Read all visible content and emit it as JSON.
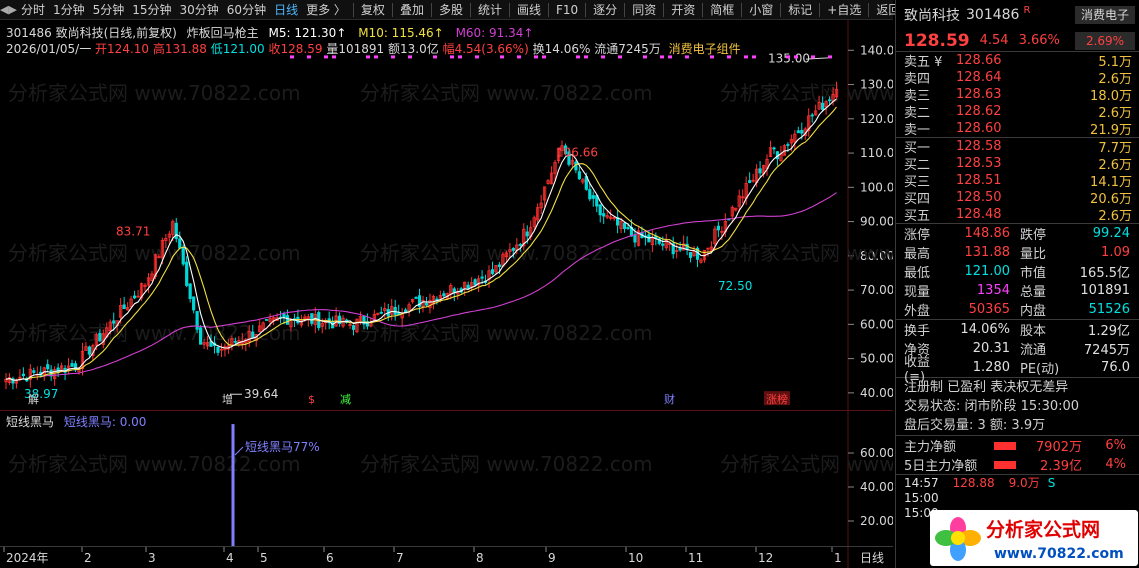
{
  "toolbar": {
    "items": [
      "分时",
      "1分钟",
      "5分钟",
      "15分钟",
      "30分钟",
      "60分钟",
      "日线",
      "更多 〉",
      "复权",
      "叠加",
      "多股",
      "统计",
      "画线",
      "F10",
      "逐分",
      "同资",
      "开资",
      "简框",
      "小窗",
      "标记",
      "+自选",
      "返回"
    ],
    "active": "日线"
  },
  "header": {
    "line1": {
      "code_name": "301486 致尚科技(日线,前复权)",
      "indicator": "炸板回马枪主",
      "m5": "M5: 121.30↑",
      "m10": "M10: 115.46↑",
      "m60": "M60: 91.34↑"
    },
    "line2": {
      "date": "2026/01/05/一",
      "open": "开124.10",
      "high": "高131.88",
      "low": "低121.00",
      "close": "收128.59",
      "vol": "量101891",
      "amt": "额13.0亿",
      "amp": "幅4.54(3.66%)",
      "turn": "换14.06%",
      "float": "流通7245万",
      "sector": "消费电子组件"
    }
  },
  "colors": {
    "up": "#ff3030",
    "down": "#00d8d8",
    "ma5": "#ffffff",
    "ma10": "#f0e040",
    "ma60": "#d040d0",
    "signal": "#8080ff"
  },
  "chart_data": {
    "type": "candlestick",
    "y_ticks": [
      "140.00",
      "130.00",
      "120.00",
      "110.00",
      "100.00",
      "90.00",
      "80.00",
      "70.00",
      "60.00",
      "50.00",
      "40.00"
    ],
    "ylim": [
      35,
      143
    ],
    "x_months": [
      "2024年",
      "2",
      "3",
      "4",
      "5",
      "6",
      "7",
      "8",
      "9",
      "10",
      "11",
      "12",
      "1"
    ],
    "x_period": "日线",
    "annotations": {
      "max1": "83.71",
      "max2": "106.66",
      "max3": "135.00",
      "min1": "39.64",
      "min2": "72.50",
      "min0": "38.97"
    },
    "markers": [
      "解",
      "增",
      "$",
      "减",
      "财",
      "涨榜"
    ],
    "key_points": [
      {
        "label": "2024年",
        "close": 44
      },
      {
        "label": "2",
        "close": 48
      },
      {
        "label": "3",
        "close": 72
      },
      {
        "label": "4",
        "close": 52
      },
      {
        "label": "5",
        "close": 62
      },
      {
        "label": "6",
        "close": 60
      },
      {
        "label": "7",
        "close": 67
      },
      {
        "label": "8",
        "close": 75
      },
      {
        "label": "9",
        "close": 100
      },
      {
        "label": "10",
        "close": 86
      },
      {
        "label": "11",
        "close": 80
      },
      {
        "label": "12",
        "close": 110
      },
      {
        "label": "1",
        "close": 128.59
      }
    ]
  },
  "sub_chart": {
    "title": "短线黑马",
    "value_label": "短线黑马: 0.00",
    "annotation": "短线黑马77%",
    "y_ticks": [
      "60.00",
      "40.00",
      "20.00"
    ],
    "signal_value": 77
  },
  "date_axis_right": "日线",
  "right_panel": {
    "name": "致尚科技",
    "code": "301486",
    "badge": "R",
    "sector_tag": "消费电子",
    "price": "128.59",
    "change": "4.54",
    "pct": "3.66%",
    "sector_pct": "2.69%",
    "asks": [
      {
        "label": "卖五 ¥",
        "price": "128.66",
        "vol": "5.1万"
      },
      {
        "label": "卖四",
        "price": "128.64",
        "vol": "2.6万"
      },
      {
        "label": "卖三",
        "price": "128.63",
        "vol": "18.0万"
      },
      {
        "label": "卖二",
        "price": "128.62",
        "vol": "2.6万"
      },
      {
        "label": "卖一",
        "price": "128.60",
        "vol": "21.9万"
      }
    ],
    "bids": [
      {
        "label": "买一",
        "price": "128.58",
        "vol": "7.7万"
      },
      {
        "label": "买二",
        "price": "128.53",
        "vol": "2.6万"
      },
      {
        "label": "买三",
        "price": "128.51",
        "vol": "14.1万"
      },
      {
        "label": "买四",
        "price": "128.50",
        "vol": "20.6万"
      },
      {
        "label": "买五",
        "price": "128.48",
        "vol": "2.6万"
      }
    ],
    "stats": [
      {
        "l1": "涨停",
        "v1": "148.86",
        "c1": "red",
        "l2": "跌停",
        "v2": "99.24",
        "c2": "green"
      },
      {
        "l1": "最高",
        "v1": "131.88",
        "c1": "red",
        "l2": "量比",
        "v2": "1.09",
        "c2": "red"
      },
      {
        "l1": "最低",
        "v1": "121.00",
        "c1": "green",
        "l2": "市值",
        "v2": "165.5亿",
        "c2": "wht"
      },
      {
        "l1": "现量",
        "v1": "1354",
        "c1": "mag",
        "l2": "总量",
        "v2": "101891",
        "c2": "wht"
      },
      {
        "l1": "外盘",
        "v1": "50365",
        "c1": "red",
        "l2": "内盘",
        "v2": "51526",
        "c2": "green"
      }
    ],
    "stats2": [
      {
        "l1": "换手",
        "v1": "14.06%",
        "l2": "股本",
        "v2": "1.29亿"
      },
      {
        "l1": "净资",
        "v1": "20.31",
        "l2": "流通",
        "v2": "7245万"
      },
      {
        "l1": "收益(≡)",
        "v1": "1.280",
        "l2": "PE(动)",
        "v2": "76.0"
      }
    ],
    "notes": [
      "注册制 已盈利 表决权无差异",
      "交易状态: 闭市阶段 15:30:00",
      "盘后交易量: 3  额: 3.9万"
    ],
    "flows": [
      {
        "label": "主力净额",
        "value": "7902万",
        "pct": "6%"
      },
      {
        "label": "5日主力净额",
        "value": "2.39亿",
        "pct": "4%"
      }
    ],
    "ticks": [
      {
        "time": "14:57",
        "price": "128.88",
        "vol": "9.0万",
        "flag": "S"
      },
      {
        "time": "15:00",
        "price": "",
        "vol": "",
        "flag": ""
      },
      {
        "time": "15:00",
        "price": "",
        "vol": "",
        "flag": ""
      }
    ]
  },
  "logo": {
    "text": "分析家公式网",
    "url": "www.70822.com"
  },
  "watermark": "分析家公式网 www.70822.com"
}
